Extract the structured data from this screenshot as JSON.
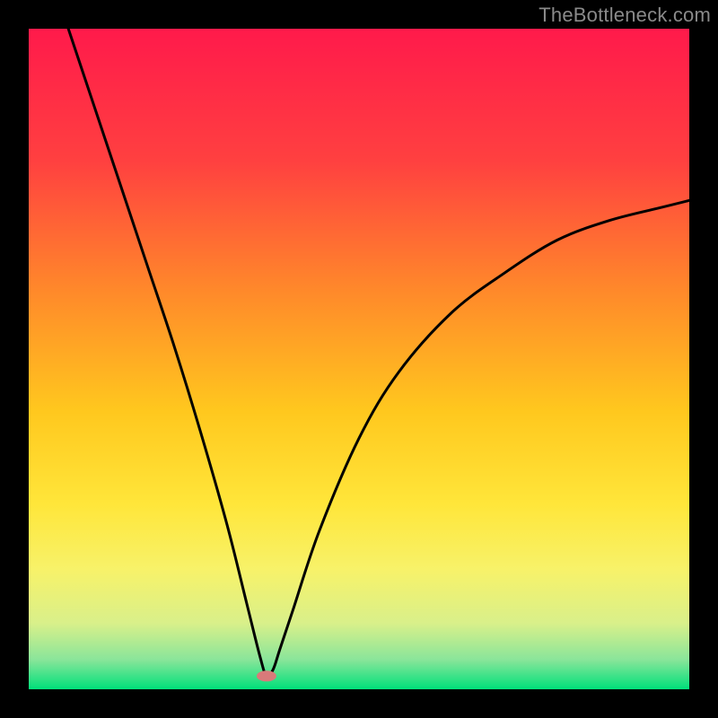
{
  "attribution": "TheBottleneck.com",
  "chart_data": {
    "type": "line",
    "title": "",
    "xlabel": "",
    "ylabel": "",
    "xlim": [
      0,
      100
    ],
    "ylim": [
      0,
      100
    ],
    "grid": false,
    "legend": false,
    "background_gradient_stops": [
      {
        "offset": 0.0,
        "color": "#ff1a4b"
      },
      {
        "offset": 0.2,
        "color": "#ff4040"
      },
      {
        "offset": 0.4,
        "color": "#ff8a2a"
      },
      {
        "offset": 0.58,
        "color": "#ffc81e"
      },
      {
        "offset": 0.72,
        "color": "#ffe63a"
      },
      {
        "offset": 0.82,
        "color": "#f7f26a"
      },
      {
        "offset": 0.9,
        "color": "#d9f08a"
      },
      {
        "offset": 0.955,
        "color": "#8ae59a"
      },
      {
        "offset": 1.0,
        "color": "#00e07a"
      }
    ],
    "curve": {
      "description": "V-shaped bottleneck curve; minimum near x≈36",
      "minimum_x": 36,
      "minimum_y": 2,
      "points": [
        {
          "x": 6,
          "y": 100
        },
        {
          "x": 10,
          "y": 88
        },
        {
          "x": 14,
          "y": 76
        },
        {
          "x": 18,
          "y": 64
        },
        {
          "x": 22,
          "y": 52
        },
        {
          "x": 26,
          "y": 39
        },
        {
          "x": 30,
          "y": 25
        },
        {
          "x": 33,
          "y": 13
        },
        {
          "x": 35,
          "y": 5
        },
        {
          "x": 36,
          "y": 2
        },
        {
          "x": 37,
          "y": 3
        },
        {
          "x": 38,
          "y": 6
        },
        {
          "x": 40,
          "y": 12
        },
        {
          "x": 44,
          "y": 24
        },
        {
          "x": 50,
          "y": 38
        },
        {
          "x": 56,
          "y": 48
        },
        {
          "x": 64,
          "y": 57
        },
        {
          "x": 72,
          "y": 63
        },
        {
          "x": 80,
          "y": 68
        },
        {
          "x": 88,
          "y": 71
        },
        {
          "x": 96,
          "y": 73
        },
        {
          "x": 100,
          "y": 74
        }
      ]
    },
    "marker": {
      "x": 36,
      "y": 2,
      "color": "#d97a7a",
      "rx": 11,
      "ry": 6
    }
  }
}
